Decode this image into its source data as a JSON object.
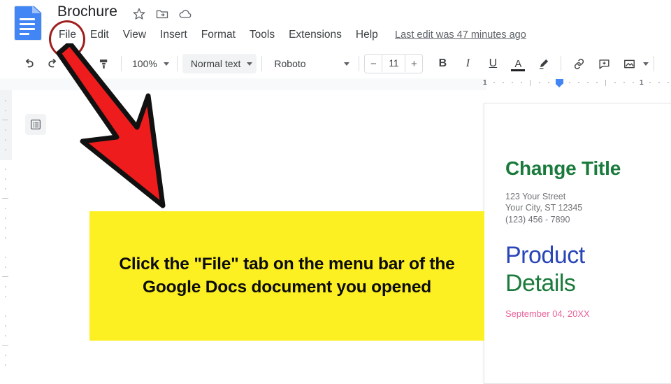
{
  "app": {
    "name": "Google Docs",
    "logo_icon": "google-docs-icon"
  },
  "titlebar": {
    "doc_title": "Brochure",
    "icons": [
      {
        "name": "star-icon",
        "label": "Star"
      },
      {
        "name": "move-to-folder-icon",
        "label": "Move"
      },
      {
        "name": "cloud-saved-icon",
        "label": "Saved to Drive"
      }
    ]
  },
  "menubar": {
    "items": [
      {
        "label": "File"
      },
      {
        "label": "Edit"
      },
      {
        "label": "View"
      },
      {
        "label": "Insert"
      },
      {
        "label": "Format"
      },
      {
        "label": "Tools"
      },
      {
        "label": "Extensions"
      },
      {
        "label": "Help"
      }
    ],
    "last_edit": "Last edit was 47 minutes ago"
  },
  "toolbar": {
    "undo_icon": "undo-icon",
    "redo_icon": "redo-icon",
    "print_icon": "print-icon",
    "paint_format_icon": "paint-format-icon",
    "zoom_value": "100%",
    "style_value": "Normal text",
    "font_value": "Roboto",
    "font_size_decrease": "−",
    "font_size_value": "11",
    "font_size_increase": "+",
    "bold_label": "B",
    "italic_label": "I",
    "underline_label": "U",
    "text_color_label": "A",
    "highlight_icon": "highlight-pen-icon",
    "link_icon": "insert-link-icon",
    "comment_icon": "add-comment-icon",
    "image_icon": "insert-image-icon"
  },
  "ruler": {
    "left_number": "1",
    "right_number": "1",
    "indent_marker": "first-line-indent-marker"
  },
  "canvas": {
    "outline_icon": "document-outline-icon"
  },
  "document": {
    "title": "Change Title",
    "address_line1": "123 Your Street",
    "address_line2": "Your City, ST 12345",
    "address_line3": "(123) 456 - 7890",
    "heading_part1": "Product",
    "heading_part2": "Details",
    "date": "September 04, 20XX"
  },
  "annotations": {
    "callout_text": "Click the \"File\" tab on the menu bar of the Google Docs document you opened",
    "highlight_target": "File",
    "arrow_name": "red-pointer-arrow",
    "circle_name": "red-highlight-circle",
    "callout_bg": "#FDF022",
    "arrow_color": "#EE1C1C",
    "circle_color": "#A01F1F"
  },
  "colors": {
    "docs_blue": "#4285F4",
    "doc_green": "#1A7A3C",
    "doc_blue": "#2A45B8",
    "doc_pink": "#E8649A"
  }
}
